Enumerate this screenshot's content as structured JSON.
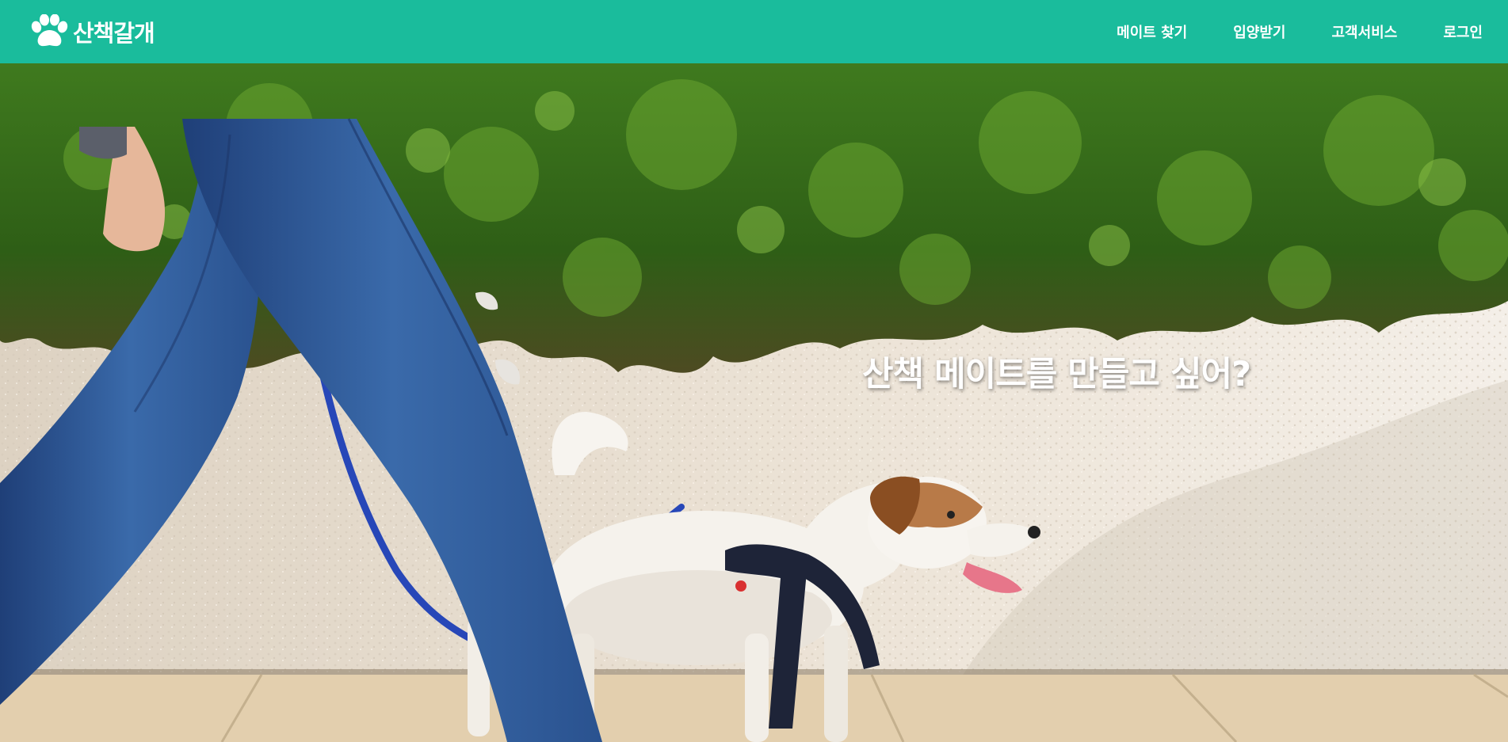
{
  "brand": {
    "name": "산책갈개",
    "logo_icon": "paw-icon"
  },
  "nav": {
    "items": [
      {
        "label": "메이트 찾기"
      },
      {
        "label": "입양받기"
      },
      {
        "label": "고객서비스"
      },
      {
        "label": "로그인"
      }
    ]
  },
  "hero": {
    "headline": "산책 메이트를 만들고 싶어?"
  },
  "colors": {
    "header_bg": "#1abc9c",
    "header_text": "#ffffff"
  }
}
